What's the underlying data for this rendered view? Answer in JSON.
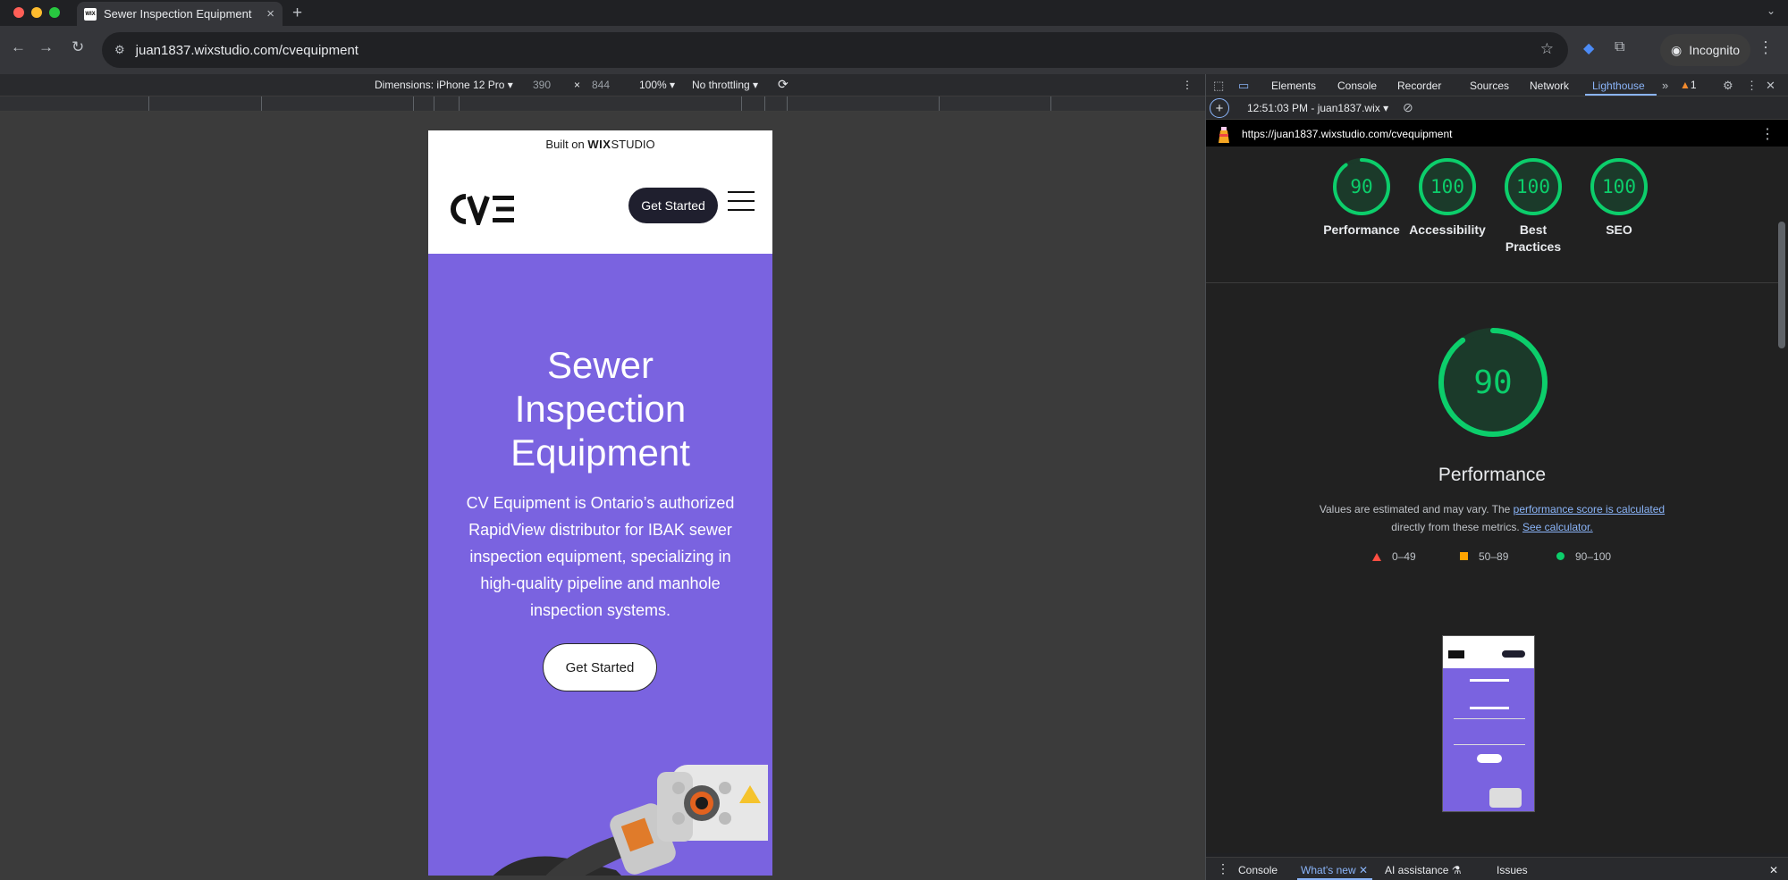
{
  "browser": {
    "tab_title": "Sewer Inspection Equipment",
    "url": "juan1837.wixstudio.com/cvequipment",
    "incognito_label": "Incognito"
  },
  "device_toolbar": {
    "dimensions_label": "Dimensions: iPhone 12 Pro",
    "width": "390",
    "times": "×",
    "height": "844",
    "zoom": "100%",
    "throttling": "No throttling"
  },
  "site": {
    "built_on_prefix": "Built on",
    "built_on_brand": "WIX",
    "built_on_suffix": "STUDIO",
    "logo_text": "CVE",
    "header_cta": "Get Started",
    "hero_title_line1": "Sewer",
    "hero_title_line2": "Inspection",
    "hero_title_line3": "Equipment",
    "hero_text": "CV Equipment is Ontario’s authorized RapidView distributor for IBAK sewer inspection equipment, specializing in high-quality pipeline and manhole inspection systems.",
    "hero_cta": "Get Started",
    "accent_color": "#7a63e0"
  },
  "devtools": {
    "tabs": [
      "Elements",
      "Console",
      "Recorder",
      "Sources",
      "Network",
      "Lighthouse"
    ],
    "active_tab": "Lighthouse",
    "warning_count": "1",
    "report_select": "12:51:03 PM - juan1837.wix",
    "report_url": "https://juan1837.wixstudio.com/cvequipment",
    "scores": [
      {
        "label": "Performance",
        "value": 90
      },
      {
        "label": "Accessibility",
        "value": 100
      },
      {
        "label": "Best Practices",
        "value": 100
      },
      {
        "label": "SEO",
        "value": 100
      }
    ],
    "perf_score": "90",
    "perf_score_value": 90,
    "perf_title": "Performance",
    "perf_desc_1": "Values are estimated and may vary. The ",
    "perf_desc_link1": "performance score is calculated",
    "perf_desc_2": " directly from these metrics. ",
    "perf_desc_link2": "See calculator.",
    "legend": {
      "low": "0–49",
      "mid": "50–89",
      "high": "90–100"
    },
    "score_color": "#0cce6b",
    "drawer_tabs": [
      "Console",
      "What's new",
      "AI assistance",
      "Issues"
    ],
    "drawer_active": "What's new"
  }
}
